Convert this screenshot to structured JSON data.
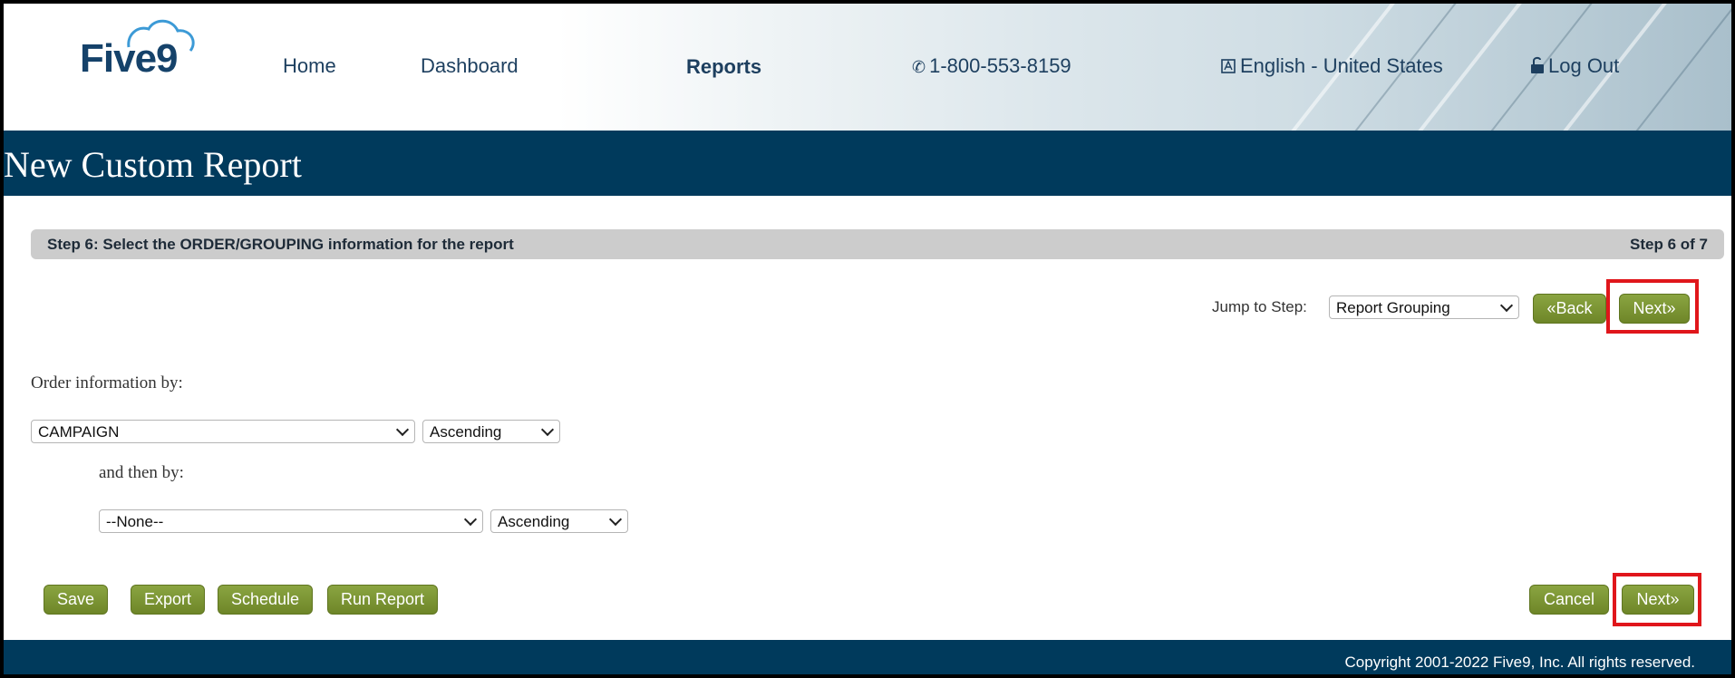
{
  "header": {
    "logo_text": "Five9",
    "nav": {
      "home": "Home",
      "dashboard": "Dashboard",
      "reports": "Reports",
      "phone": "1-800-553-8159",
      "language": "English - United States",
      "logout": "Log Out"
    }
  },
  "page_title": "New Custom Report",
  "step_bar": {
    "left_prefix": "Step 6: Select the ",
    "left_emph": "ORDER/GROUPING",
    "left_suffix": " information for the report",
    "right": "Step 6 of 7"
  },
  "jump": {
    "label": "Jump to Step:",
    "selected": "Report Grouping",
    "back_label": "«Back",
    "next_label": "Next»"
  },
  "order": {
    "label": "Order information by:",
    "field1": "CAMPAIGN",
    "direction1": "Ascending",
    "then_label": "and then by:",
    "field2": "--None--",
    "direction2": "Ascending"
  },
  "actions": {
    "save": "Save",
    "export": "Export",
    "schedule": "Schedule",
    "run_report": "Run Report",
    "cancel": "Cancel",
    "next": "Next»"
  },
  "footer": {
    "copyright": "Copyright 2001-2022 Five9, Inc. All rights reserved."
  },
  "colors": {
    "header_band": "#003a5c",
    "button_green": "#7a9332",
    "highlight_red": "#e0161b",
    "nav_text": "#1d3f5f"
  },
  "icons": [
    "cloud-logo-icon",
    "phone-icon",
    "language-icon",
    "unlock-icon",
    "chevron-down-icon"
  ]
}
